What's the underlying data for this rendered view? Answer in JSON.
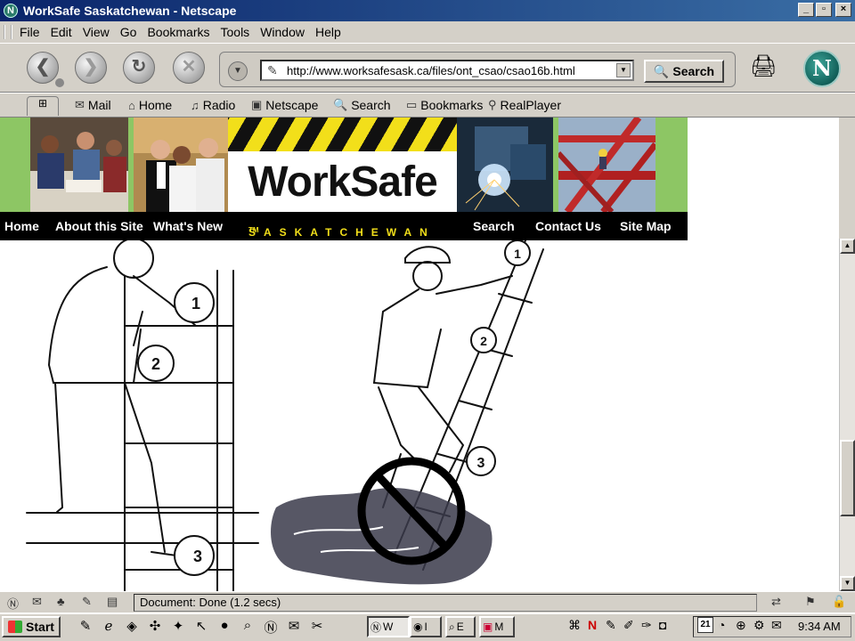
{
  "window": {
    "title": "WorkSafe Saskatchewan - Netscape",
    "app_icon": "netscape-icon",
    "buttons": [
      "_",
      "▫",
      "×"
    ]
  },
  "menu": [
    "File",
    "Edit",
    "View",
    "Go",
    "Bookmarks",
    "Tools",
    "Window",
    "Help"
  ],
  "navigation": {
    "back_icon": "back-icon",
    "forward_icon": "forward-icon",
    "reload_icon": "reload-icon",
    "stop_icon": "stop-icon",
    "url": "http://www.worksafesask.ca/files/ont_csao/csao16b.html",
    "search_label": "Search",
    "brand_letter": "N"
  },
  "personal_toolbar": [
    "Mail",
    "Home",
    "Radio",
    "Netscape",
    "Search",
    "Bookmarks",
    "RealPlayer"
  ],
  "site": {
    "logo": "WorkSafe",
    "province": "SASKATCHEWAN",
    "trademark": "TM",
    "nav": [
      "Home",
      "About this Site",
      "What's New",
      "Search",
      "Contact Us",
      "Site Map"
    ]
  },
  "illustration": {
    "callouts_left": [
      "1",
      "2",
      "3"
    ],
    "callouts_right": [
      "1",
      "2",
      "3"
    ]
  },
  "status": {
    "text": "Document: Done (1.2 secs)"
  },
  "taskbar": {
    "start_label": "Start",
    "tasks": [
      "W",
      "I",
      "E",
      "M"
    ],
    "calendar_day": "21",
    "clock": "9:34 AM"
  },
  "colors": {
    "titlebar_start": "#0a246a",
    "titlebar_end": "#3a6ea5",
    "banner_green": "#8dc664",
    "hazard_yellow": "#f2df1a",
    "nav_black": "#000000"
  }
}
